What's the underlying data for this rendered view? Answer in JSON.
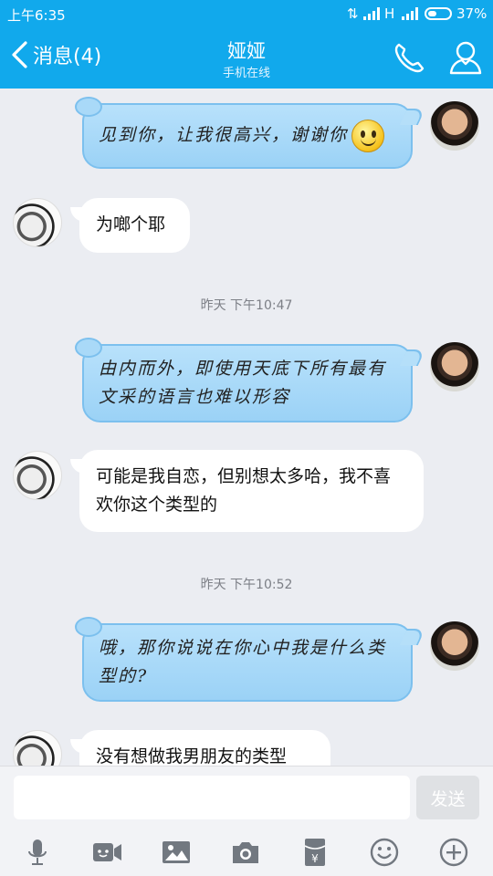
{
  "status_bar": {
    "time": "上午6:35",
    "network": "H",
    "battery": "37%"
  },
  "header": {
    "back_label": "消息(4)",
    "title": "娅娅",
    "subtitle": "手机在线"
  },
  "messages": [
    {
      "sender": "me",
      "text": "见到你，让我很高兴，谢谢你",
      "emoji": "smile-emoji"
    },
    {
      "sender": "her",
      "text": "为啷个耶"
    },
    {
      "timestamp": "昨天 下午10:47"
    },
    {
      "sender": "me",
      "text": "由内而外，即使用天底下所有最有文采的语言也难以形容"
    },
    {
      "sender": "her",
      "text": "可能是我自恋，但别想太多哈，我不喜欢你这个类型的"
    },
    {
      "timestamp": "昨天 下午10:52"
    },
    {
      "sender": "me",
      "text": "哦，那你说说在你心中我是什么类型的?"
    },
    {
      "sender": "her",
      "text": "没有想做我男朋友的类型"
    }
  ],
  "input": {
    "value": "",
    "send_label": "发送"
  },
  "toolbar_icons": [
    "microphone-icon",
    "video-icon",
    "image-icon",
    "camera-icon",
    "red-packet-icon",
    "emoji-icon",
    "plus-icon"
  ],
  "colors": {
    "header_bg": "#11a9ec",
    "my_bubble": "#a8d8f8",
    "their_bubble": "#ffffff",
    "chat_bg": "#ebedf2"
  }
}
